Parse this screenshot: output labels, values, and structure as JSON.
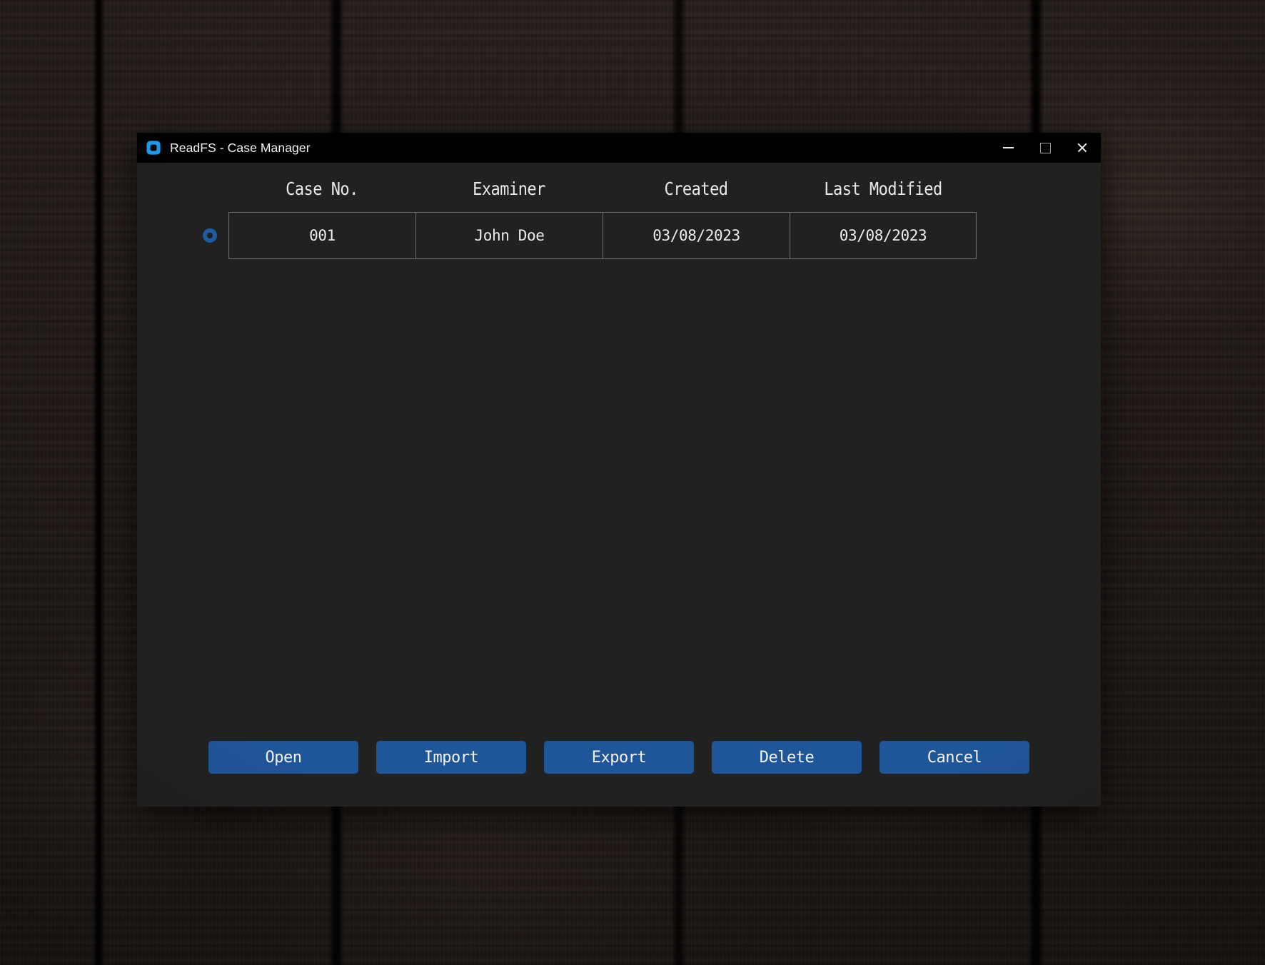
{
  "window": {
    "title": "ReadFS - Case Manager",
    "icon": "readfs-app-icon",
    "accent_color": "#1f5599",
    "title_bar_color": "#000000",
    "body_color": "#212121",
    "controls": {
      "minimize": "minimize-icon",
      "maximize": "maximize-icon",
      "close": "close-icon"
    }
  },
  "table": {
    "columns": [
      "Case No.",
      "Examiner",
      "Created",
      "Last Modified"
    ],
    "rows": [
      {
        "selected": true,
        "case_no": "001",
        "examiner": "John Doe",
        "created": "03/08/2023",
        "last_modified": "03/08/2023"
      }
    ]
  },
  "buttons": [
    {
      "label": "Open"
    },
    {
      "label": "Import"
    },
    {
      "label": "Export"
    },
    {
      "label": "Delete"
    },
    {
      "label": "Cancel"
    }
  ]
}
